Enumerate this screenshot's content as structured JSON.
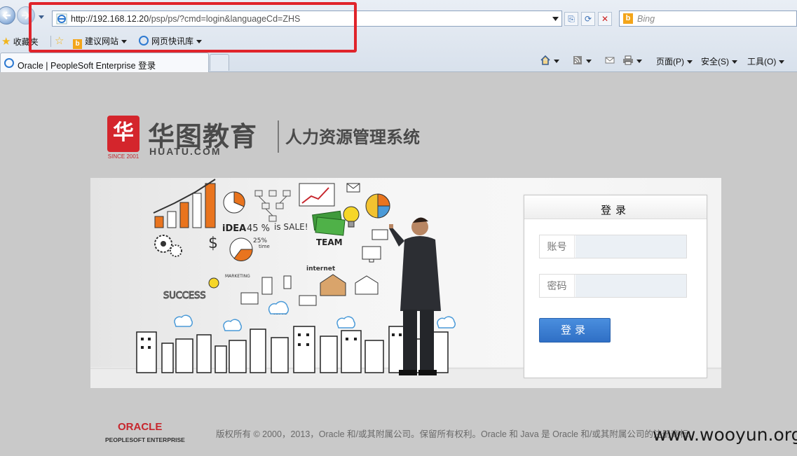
{
  "browser": {
    "url_host": "http://192.168.12.20",
    "url_path": "/psp/ps/?cmd=login&languageCd=ZHS",
    "search_placeholder": "Bing",
    "favorites": {
      "center_label": "收藏夹",
      "suggested_sites": "建议网站",
      "web_slice_gallery": "网页快讯库"
    },
    "tab_title": "Oracle | PeopleSoft Enterprise 登录",
    "commands": {
      "page": "页面(P)",
      "safety": "安全(S)",
      "tools": "工具(O)"
    },
    "highlight_color": "#e0242b"
  },
  "branding": {
    "logo_mark": "华",
    "logo_since": "SINCE 2001",
    "logo_cn": "华图教育",
    "logo_en": "HUATU.COM",
    "system_name": "人力资源管理系统",
    "brand_red": "#d4252c"
  },
  "login": {
    "title": "登录",
    "account_label": "账号",
    "password_label": "密码",
    "button_label": "登录",
    "button_color": "#3a7fd5"
  },
  "footer": {
    "oracle": "ORACLE",
    "oracle_sub": "PEOPLESOFT ENTERPRISE",
    "copyright": "版权所有 © 2000，2013，Oracle 和/或其附属公司。保留所有权利。Oracle 和 Java 是 Oracle 和/或其附属公司的注册商标。",
    "watermark": "www.wooyun.org"
  },
  "banner_words": {
    "idea": "iDEA",
    "percent45": "45 %",
    "sale": "is SALE!",
    "team": "TEAM",
    "percent25": "25%",
    "time": "time",
    "marketing": "MARKETING",
    "internet": "internet",
    "success": "SUCCESS",
    "cloud": "CLOUD",
    "dollar": "$"
  }
}
